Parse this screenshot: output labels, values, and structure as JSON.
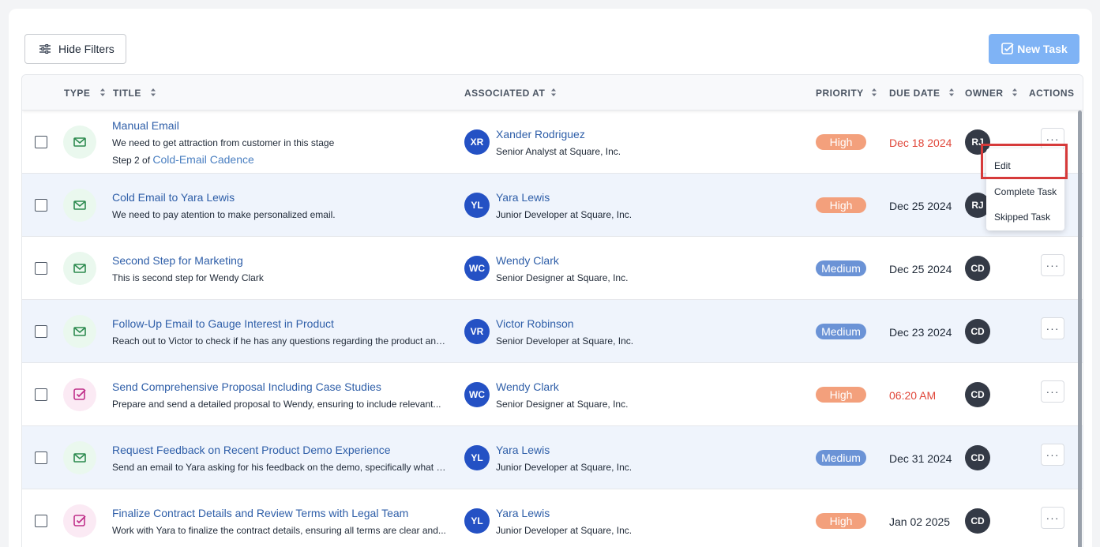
{
  "toolbar": {
    "hide_filters": "Hide Filters",
    "new_task": "New Task"
  },
  "columns": {
    "type": "TYPE",
    "title": "TITLE",
    "associated": "ASSOCIATED AT",
    "priority": "PRIORITY",
    "due": "DUE DATE",
    "owner": "OWNER",
    "actions": "ACTIONS"
  },
  "colors": {
    "accent": "#7fb3f5",
    "high": "#f3a07c",
    "medium": "#6b93d6",
    "overdue": "#e0473a",
    "highlight": "#d63a3a"
  },
  "rows": [
    {
      "type": "envelope-icon",
      "title": "Manual Email",
      "desc": "We need to get attraction from customer in this stage",
      "step_prefix": "Step 2 of",
      "step_link": "Cold-Email Cadence",
      "initials": "XR",
      "name": "Xander Rodriguez",
      "role": "Senior Analyst at Square, Inc.",
      "priority": "High",
      "due": "Dec 18 2024",
      "owner": "RJ"
    },
    {
      "type": "envelope-icon",
      "title": "Cold Email to Yara Lewis",
      "desc": "We need to pay atention to make personalized email.",
      "initials": "YL",
      "name": "Yara Lewis",
      "role": "Junior Developer at Square, Inc.",
      "priority": "High",
      "due": "Dec 25 2024",
      "owner": "RJ"
    },
    {
      "type": "envelope-icon",
      "title": "Second Step for Marketing",
      "desc": "This is second step for Wendy Clark",
      "initials": "WC",
      "name": "Wendy Clark",
      "role": "Senior Designer at Square, Inc.",
      "priority": "Medium",
      "due": "Dec 25 2024",
      "owner": "CD"
    },
    {
      "type": "envelope-icon",
      "title": "Follow-Up Email to Gauge Interest in Product",
      "desc": "Reach out to Victor to check if he has any questions regarding the product and...",
      "initials": "VR",
      "name": "Victor Robinson",
      "role": "Senior Developer at Square, Inc.",
      "priority": "Medium",
      "due": "Dec 23 2024",
      "owner": "CD"
    },
    {
      "type": "checkbox-task-icon",
      "title": "Send Comprehensive Proposal Including Case Studies",
      "desc": "Prepare and send a detailed proposal to Wendy, ensuring to include relevant...",
      "initials": "WC",
      "name": "Wendy Clark",
      "role": "Senior Designer at Square, Inc.",
      "priority": "High",
      "due": "06:20 AM",
      "owner": "CD"
    },
    {
      "type": "envelope-icon",
      "title": "Request Feedback on Recent Product Demo Experience",
      "desc": "Send an email to Yara asking for his feedback on the demo, specifically what h...",
      "initials": "YL",
      "name": "Yara Lewis",
      "role": "Junior Developer at Square, Inc.",
      "priority": "Medium",
      "due": "Dec 31 2024",
      "owner": "CD"
    },
    {
      "type": "checkbox-task-icon",
      "title": "Finalize Contract Details and Review Terms with Legal Team",
      "desc": "Work with Yara to finalize the contract details, ensuring all terms are clear and...",
      "initials": "YL",
      "name": "Yara Lewis",
      "role": "Junior Developer at Square, Inc.",
      "priority": "High",
      "due": "Jan 02 2025",
      "owner": "CD"
    }
  ],
  "menu": {
    "edit": "Edit",
    "complete": "Complete Task",
    "skipped": "Skipped Task"
  },
  "actions_label": "···"
}
